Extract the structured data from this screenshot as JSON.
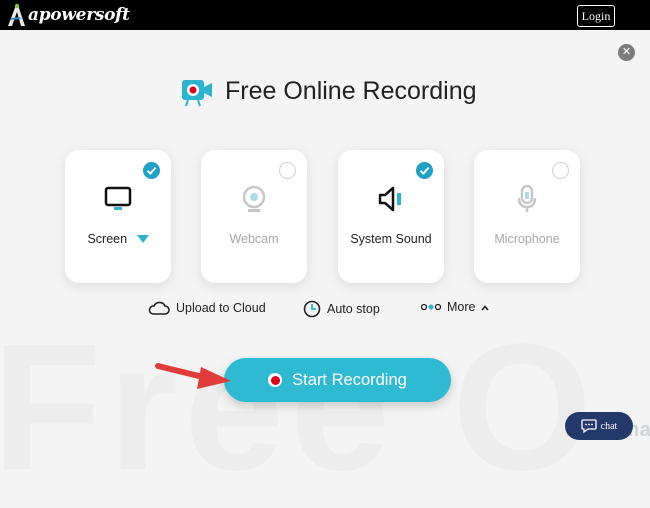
{
  "header": {
    "brand": "apowersoft",
    "login_label": "Login"
  },
  "main": {
    "title": "Free Online Recording",
    "background_word": "Free O",
    "sources": [
      {
        "label": "Screen",
        "checked": true,
        "icon": "monitor-icon"
      },
      {
        "label": "Webcam",
        "checked": false,
        "icon": "webcam-icon"
      },
      {
        "label": "System Sound",
        "checked": true,
        "icon": "speaker-icon"
      },
      {
        "label": "Microphone",
        "checked": false,
        "icon": "microphone-icon"
      }
    ],
    "options": {
      "upload": "Upload to Cloud",
      "autostop": "Auto stop",
      "more": "More"
    },
    "start_label": "Start Recording"
  },
  "chat": {
    "label": "chat"
  },
  "watermark": "filepuma",
  "colors": {
    "accent": "#2fbad3",
    "record_red": "#e0001b",
    "arrow_red": "#e23b3b",
    "chat_bg": "#22396a"
  }
}
